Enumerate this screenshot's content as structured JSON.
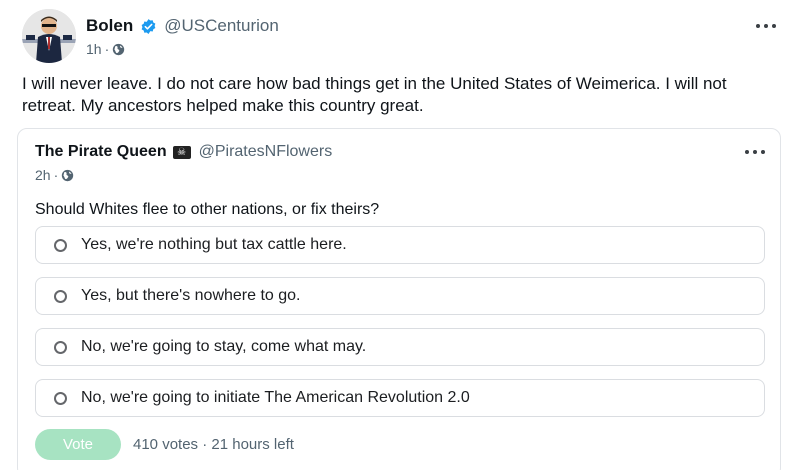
{
  "post": {
    "author": {
      "display_name": "Bolen",
      "handle": "@USCenturion",
      "verified": true,
      "badge_color": "#1d9bf0"
    },
    "meta": {
      "time": "1h",
      "separator": "·",
      "visibility_icon": "globe-icon"
    },
    "text": "I will never leave. I do not care how bad things get in the United States of Weimerica. I will not retreat. My ancestors helped make this country great.",
    "more_icon": "more-horizontal-icon"
  },
  "quote": {
    "author": {
      "display_name": "The Pirate Queen",
      "flag_icon": "pirate-flag-icon",
      "flag_glyph": "☠",
      "handle": "@PiratesNFlowers"
    },
    "meta": {
      "time": "2h",
      "separator": "·",
      "visibility_icon": "globe-icon"
    },
    "poll": {
      "question": "Should Whites flee to other nations, or fix theirs?",
      "options": [
        {
          "label": "Yes, we're nothing but tax cattle here."
        },
        {
          "label": "Yes, but there's nowhere to go."
        },
        {
          "label": "No, we're going to stay, come what may."
        },
        {
          "label": "No, we're going to initiate The American Revolution 2.0"
        }
      ],
      "vote_button_label": "Vote",
      "vote_button_color": "#a7e3c2",
      "vote_count_text": "410 votes",
      "separator": "·",
      "time_left_text": "21 hours left"
    }
  }
}
